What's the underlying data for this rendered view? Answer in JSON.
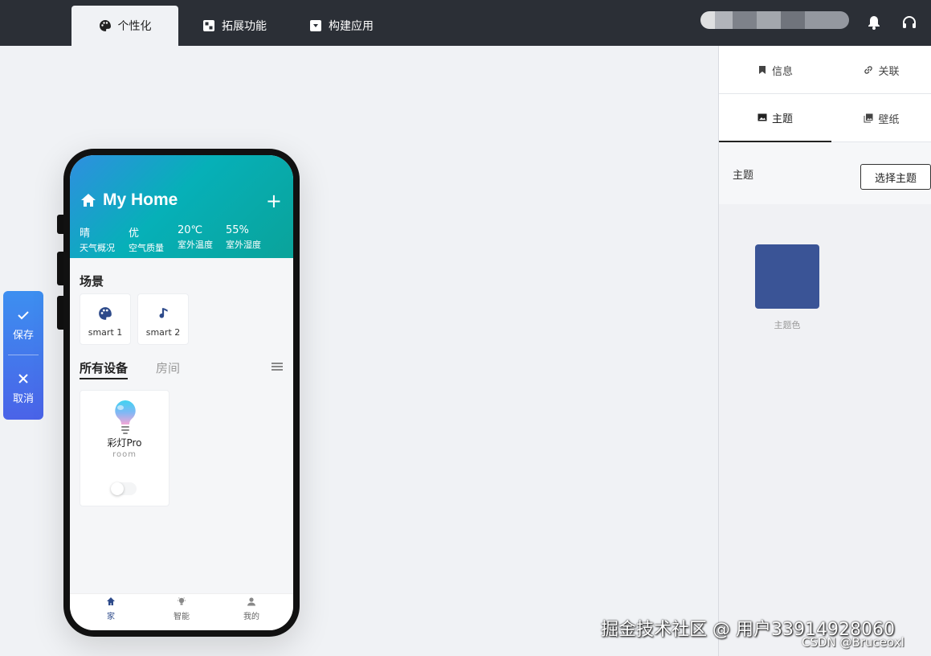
{
  "topbar": {
    "tabs": [
      {
        "label": "个性化",
        "icon": "palette-icon",
        "active": true
      },
      {
        "label": "拓展功能",
        "icon": "puzzle-icon",
        "active": false
      },
      {
        "label": "构建应用",
        "icon": "box-icon",
        "active": false
      }
    ],
    "icons": [
      "bell-icon",
      "headset-icon"
    ]
  },
  "phone": {
    "header": {
      "title": "My Home",
      "home_icon": "home-icon",
      "add_icon": "plus-icon"
    },
    "weather": [
      {
        "value": "晴",
        "label": "天气概况"
      },
      {
        "value": "优",
        "label": "空气质量"
      },
      {
        "value": "20℃",
        "label": "室外温度"
      },
      {
        "value": "55%",
        "label": "室外湿度"
      }
    ],
    "scenes_title": "场景",
    "scenes": [
      {
        "label": "smart 1",
        "icon": "palette-icon"
      },
      {
        "label": "smart 2",
        "icon": "music-note-icon"
      }
    ],
    "device_tabs": [
      {
        "label": "所有设备",
        "active": true
      },
      {
        "label": "房间",
        "active": false
      }
    ],
    "devices": [
      {
        "name": "彩灯Pro",
        "room": "room",
        "icon": "bulb-icon",
        "on": false
      }
    ],
    "bottom_nav": [
      {
        "label": "家",
        "icon": "home-icon",
        "active": true
      },
      {
        "label": "智能",
        "icon": "bulb-icon",
        "active": false
      },
      {
        "label": "我的",
        "icon": "user-icon",
        "active": false
      }
    ]
  },
  "actions": {
    "save": "保存",
    "cancel": "取消"
  },
  "panel": {
    "tabs_row1": [
      {
        "label": "信息",
        "icon": "bookmark-icon"
      },
      {
        "label": "关联",
        "icon": "link-icon"
      }
    ],
    "tabs_row2": [
      {
        "label": "主题",
        "icon": "image-icon",
        "active": true
      },
      {
        "label": "壁纸",
        "icon": "gallery-icon",
        "active": false
      }
    ],
    "theme_label": "主题",
    "theme_button": "选择主题",
    "swatch_label": "主题色",
    "theme_color": "#3a5496"
  },
  "watermark": {
    "line1": "掘金技术社区 @ 用户3391492806​0",
    "line2": "CSDN @Bruceoxl"
  }
}
